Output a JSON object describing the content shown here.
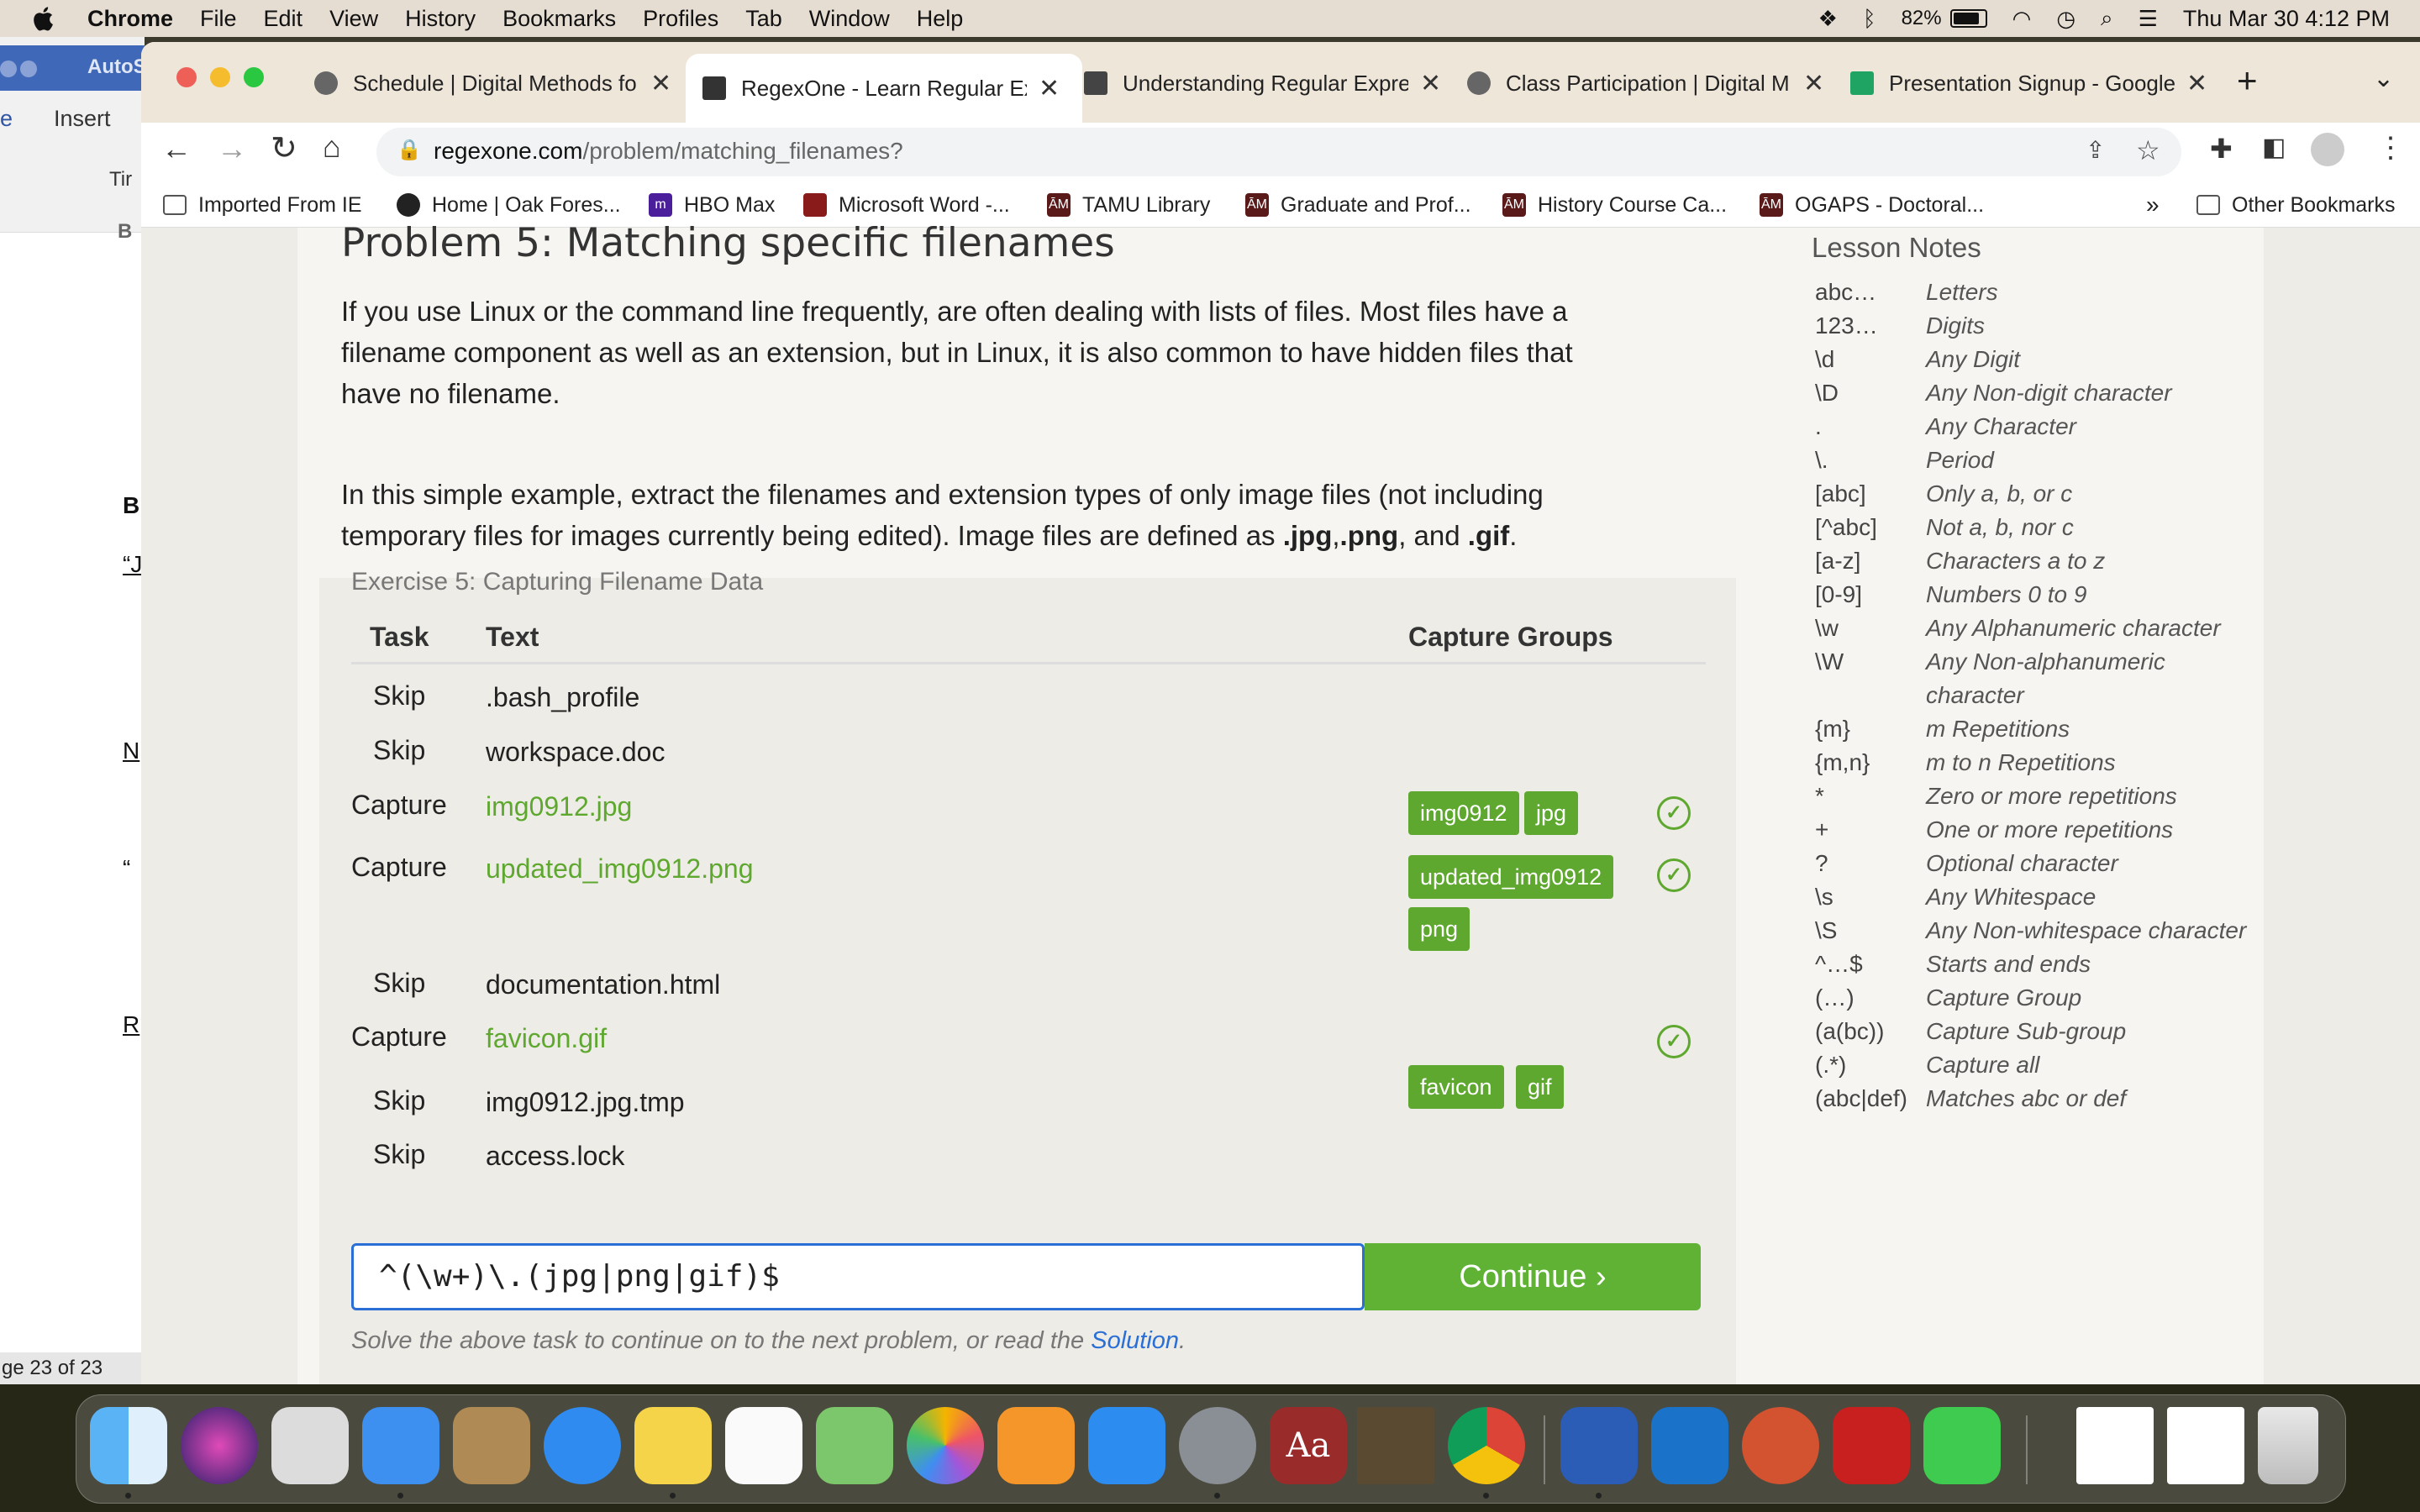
{
  "menubar": {
    "app_name": "Chrome",
    "items": [
      "File",
      "Edit",
      "View",
      "History",
      "Bookmarks",
      "Profiles",
      "Tab",
      "Window",
      "Help"
    ],
    "battery": "82%",
    "datetime": "Thu Mar 30  4:12 PM"
  },
  "word_window": {
    "title": "AutoS",
    "tab_home": "e",
    "tab_insert": "Insert",
    "font_box": "Tir",
    "status": "ge 23 of 23",
    "letters": [
      "B",
      "“J",
      "N",
      "“",
      "R"
    ]
  },
  "tabs": [
    {
      "title": "Schedule | Digital Methods fo",
      "active": false
    },
    {
      "title": "RegexOne - Learn Regular Ex",
      "active": true
    },
    {
      "title": "Understanding Regular Expre",
      "active": false
    },
    {
      "title": "Class Participation | Digital M",
      "active": false
    },
    {
      "title": "Presentation Signup - Google",
      "active": false
    }
  ],
  "address": {
    "domain": "regexone.com",
    "path": "/problem/matching_filenames?"
  },
  "bookmarks": [
    "Imported From IE",
    "Home | Oak Fores...",
    "HBO Max",
    "Microsoft Word -...",
    "TAMU Library",
    "Graduate and Prof...",
    "History Course Ca...",
    "OGAPS - Doctoral..."
  ],
  "bookmarks_more": "»",
  "other_bookmarks": "Other Bookmarks",
  "lesson": {
    "title": "Problem 5: Matching specific filenames",
    "para1_line1": "If you use Linux or the command line frequently, are often dealing with lists of files. Most files have a",
    "para1_line2": "filename component as well as an extension, but in Linux, it is also common to have hidden files that",
    "para1_line3": "have no filename.",
    "para2_line1": "In this simple example, extract the filenames and extension types of only image files (not including",
    "para2_line2a": "temporary files for images currently being edited). Image files are defined as ",
    "ext1": ".jpg",
    "sep1": ",",
    "ext2": ".png",
    "sep2": ", and ",
    "ext3": ".gif",
    "end": "."
  },
  "exercise": {
    "title": "Exercise 5: Capturing Filename Data",
    "col_task": "Task",
    "col_text": "Text",
    "col_groups": "Capture Groups",
    "rows": [
      {
        "task": "Skip",
        "text": ".bash_profile",
        "groups": []
      },
      {
        "task": "Skip",
        "text": "workspace.doc",
        "groups": []
      },
      {
        "task": "Capture",
        "text": "img0912.jpg",
        "groups": [
          "img0912",
          "jpg"
        ]
      },
      {
        "task": "Capture",
        "text": "updated_img0912.png",
        "groups": [
          "updated_img0912",
          "png"
        ]
      },
      {
        "task": "Skip",
        "text": "documentation.html",
        "groups": []
      },
      {
        "task": "Capture",
        "text": "favicon.gif",
        "groups": [
          "favicon",
          "gif"
        ]
      },
      {
        "task": "Skip",
        "text": "img0912.jpg.tmp",
        "groups": []
      },
      {
        "task": "Skip",
        "text": "access.lock",
        "groups": []
      }
    ],
    "input_value": "^(\\w+)\\.(jpg|png|gif)$",
    "continue_label": "Continue ›",
    "hint_text": "Solve the above task to continue on to the next problem, or read the ",
    "hint_link": "Solution",
    "hint_end": "."
  },
  "notes": {
    "title": "Lesson Notes",
    "items": [
      {
        "key": "abc…",
        "desc": "Letters"
      },
      {
        "key": "123…",
        "desc": "Digits"
      },
      {
        "key": "\\d",
        "desc": "Any Digit"
      },
      {
        "key": "\\D",
        "desc": "Any Non-digit character"
      },
      {
        "key": ".",
        "desc": "Any Character"
      },
      {
        "key": "\\.",
        "desc": "Period"
      },
      {
        "key": "[abc]",
        "desc": "Only a, b, or c"
      },
      {
        "key": "[^abc]",
        "desc": "Not a, b, nor c"
      },
      {
        "key": "[a-z]",
        "desc": "Characters a to z"
      },
      {
        "key": "[0-9]",
        "desc": "Numbers 0 to 9"
      },
      {
        "key": "\\w",
        "desc": "Any Alphanumeric character"
      },
      {
        "key": "\\W",
        "desc": "Any Non-alphanumeric"
      },
      {
        "key": "",
        "desc": "character"
      },
      {
        "key": "{m}",
        "desc": "m Repetitions"
      },
      {
        "key": "{m,n}",
        "desc": "m to n Repetitions"
      },
      {
        "key": "*",
        "desc": "Zero or more repetitions"
      },
      {
        "key": "+",
        "desc": "One or more repetitions"
      },
      {
        "key": "?",
        "desc": "Optional character"
      },
      {
        "key": "\\s",
        "desc": "Any Whitespace"
      },
      {
        "key": "\\S",
        "desc": "Any Non-whitespace character"
      },
      {
        "key": "^…$",
        "desc": "Starts and ends"
      },
      {
        "key": "(…)",
        "desc": "Capture Group"
      },
      {
        "key": "(a(bc))",
        "desc": "Capture Sub-group"
      },
      {
        "key": "(.*)",
        "desc": "Capture all"
      },
      {
        "key": "(abc|def)",
        "desc": "Matches abc or def"
      }
    ]
  },
  "dock": {
    "apps": [
      "finder",
      "siri",
      "launchpad",
      "mail",
      "contacts",
      "safari",
      "notes",
      "reminders",
      "maps",
      "photos",
      "books",
      "app-store",
      "system-preferences",
      "dictionary",
      "medieval-ii",
      "chrome",
      "word",
      "outlook",
      "powerpoint",
      "acrobat",
      "messages",
      "document-1",
      "document-2",
      "trash"
    ],
    "dictionary_label": "Aa"
  },
  "colors": {
    "accent_green": "#5fa830",
    "link_blue": "#2a6fd6",
    "menubar": "#e6ddd2",
    "tabstrip": "#efe6da"
  }
}
